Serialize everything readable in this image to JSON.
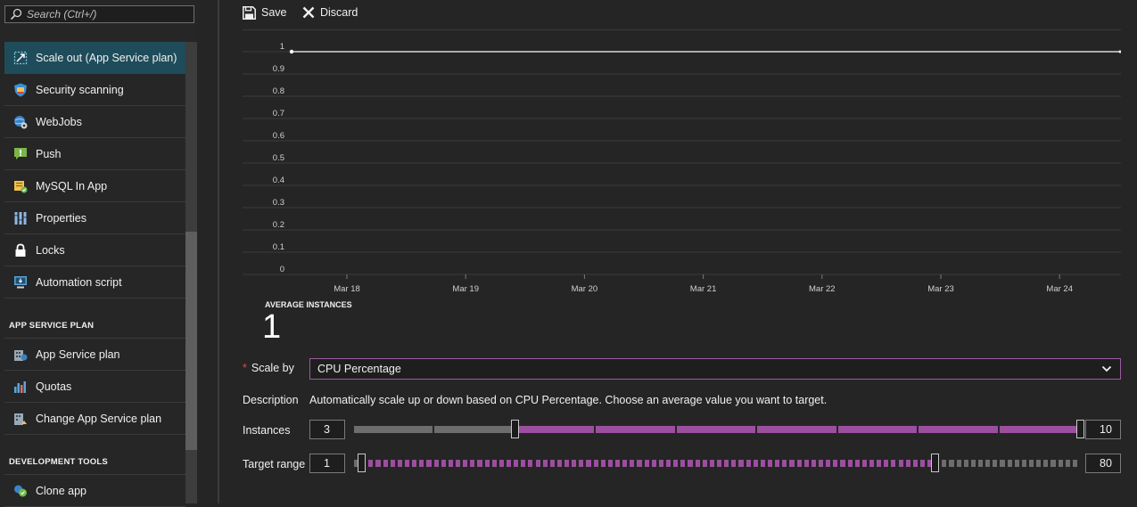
{
  "search": {
    "placeholder": "Search (Ctrl+/)"
  },
  "sidebar": {
    "items_top": [
      {
        "label": "Scale out (App Service plan)",
        "icon": "scale-out-icon",
        "active": true
      },
      {
        "label": "Security scanning",
        "icon": "shield-icon"
      },
      {
        "label": "WebJobs",
        "icon": "webjobs-icon"
      },
      {
        "label": "Push",
        "icon": "push-icon"
      },
      {
        "label": "MySQL In App",
        "icon": "mysql-icon"
      },
      {
        "label": "Properties",
        "icon": "properties-icon"
      },
      {
        "label": "Locks",
        "icon": "lock-icon"
      },
      {
        "label": "Automation script",
        "icon": "automation-icon"
      }
    ],
    "section_app_service_plan": "APP SERVICE PLAN",
    "items_plan": [
      {
        "label": "App Service plan",
        "icon": "app-service-plan-icon"
      },
      {
        "label": "Quotas",
        "icon": "quotas-icon"
      },
      {
        "label": "Change App Service plan",
        "icon": "change-plan-icon"
      }
    ],
    "section_dev_tools": "DEVELOPMENT TOOLS",
    "items_dev": [
      {
        "label": "Clone app",
        "icon": "clone-icon"
      }
    ]
  },
  "toolbar": {
    "save_label": "Save",
    "discard_label": "Discard"
  },
  "chart_data": {
    "type": "line",
    "x": [
      "Mar 18",
      "Mar 19",
      "Mar 20",
      "Mar 21",
      "Mar 22",
      "Mar 23",
      "Mar 24"
    ],
    "yticks": [
      "1",
      "0.9",
      "0.8",
      "0.7",
      "0.6",
      "0.5",
      "0.4",
      "0.3",
      "0.2",
      "0.1",
      "0"
    ],
    "ylim": [
      0,
      1
    ],
    "series": [
      {
        "values": [
          1,
          1,
          1,
          1,
          1,
          1,
          1
        ],
        "color": "#d8d8d8"
      }
    ],
    "grid": true
  },
  "average_instances": {
    "label": "AVERAGE INSTANCES",
    "value": "1"
  },
  "form": {
    "scale_by_label": "Scale by",
    "scale_by_value": "CPU Percentage",
    "description_label": "Description",
    "description_text": "Automatically scale up or down based on CPU Percentage. Choose an average value you want to target.",
    "instances_label": "Instances",
    "instances_min": "3",
    "instances_max": "10",
    "instances_range": [
      1,
      10
    ],
    "target_label": "Target range",
    "target_min": "1",
    "target_max": "80",
    "target_range": [
      0,
      100
    ]
  },
  "colors": {
    "accent": "#9b4f9e",
    "active_item": "#1f4c5b",
    "track_inactive": "#6d6d6d"
  }
}
